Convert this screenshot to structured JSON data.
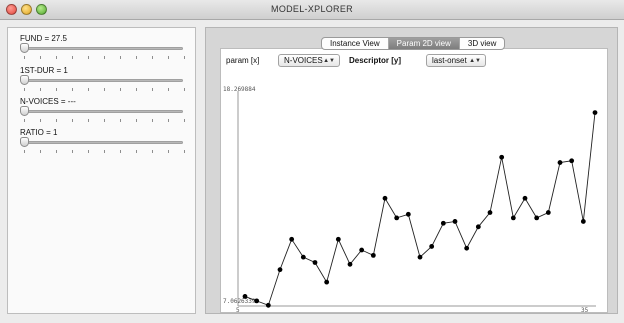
{
  "window": {
    "title": "MODEL-XPLORER"
  },
  "sliders": [
    {
      "label": "FUND = 27.5",
      "value": 0
    },
    {
      "label": "1ST-DUR = 1",
      "value": 0
    },
    {
      "label": "N-VOICES = ---",
      "value": 0
    },
    {
      "label": "RATIO = 1",
      "value": 0
    }
  ],
  "tabs": [
    {
      "label": "Instance View",
      "selected": false
    },
    {
      "label": "Param 2D view",
      "selected": true
    },
    {
      "label": "3D view",
      "selected": false
    }
  ],
  "controls": {
    "param_label": "param [x]",
    "param_value": "N-VOICES",
    "descriptor_label": "Descriptor [y]",
    "descriptor_value": "last-onset"
  },
  "chart_data": {
    "type": "line",
    "y_max_label": "18.269884",
    "y_min_label": "7.0626339",
    "x_min_label": "5",
    "x_max_label": "35",
    "xlim": [
      5,
      35
    ],
    "ylim": [
      7.0626339,
      18.269884
    ],
    "x": [
      5,
      6,
      7,
      8,
      9,
      10,
      11,
      12,
      13,
      14,
      15,
      16,
      17,
      18,
      19,
      20,
      21,
      22,
      23,
      24,
      25,
      26,
      27,
      28,
      29,
      30,
      31,
      32,
      33,
      34,
      35
    ],
    "y": [
      7.6,
      7.35,
      7.1,
      9.1,
      10.8,
      9.8,
      9.5,
      8.4,
      10.8,
      9.4,
      10.2,
      9.9,
      13.1,
      12.0,
      12.2,
      9.8,
      10.4,
      11.7,
      11.8,
      10.3,
      11.5,
      12.3,
      15.4,
      12.0,
      13.1,
      12.0,
      12.3,
      15.1,
      15.2,
      11.8,
      17.9
    ]
  }
}
